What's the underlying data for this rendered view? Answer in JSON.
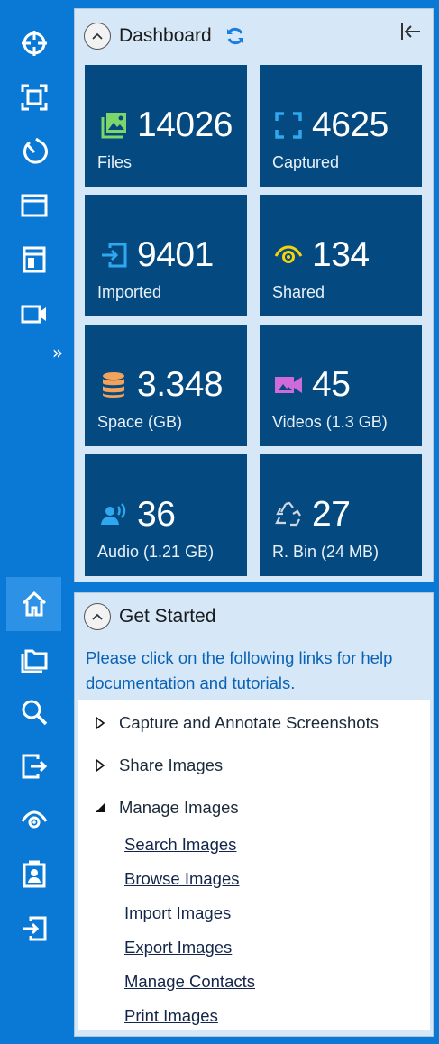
{
  "sidebar": {
    "top_buttons": [
      {
        "name": "crosshair-icon"
      },
      {
        "name": "region-capture-icon"
      },
      {
        "name": "timer-capture-icon"
      },
      {
        "name": "window-capture-icon"
      },
      {
        "name": "scroll-capture-icon"
      },
      {
        "name": "video-capture-icon"
      }
    ],
    "expand_glyph": "»",
    "bottom_buttons": [
      {
        "name": "home-icon",
        "active": true
      },
      {
        "name": "browse-icon"
      },
      {
        "name": "search-icon"
      },
      {
        "name": "export-icon"
      },
      {
        "name": "share-icon"
      },
      {
        "name": "contacts-icon"
      },
      {
        "name": "import-icon"
      }
    ]
  },
  "dashboard": {
    "title": "Dashboard",
    "tiles": [
      {
        "value": "14026",
        "label": "Files",
        "icon": "image-icon",
        "color": "#7dd66b"
      },
      {
        "value": "4625",
        "label": "Captured",
        "icon": "capture-frame-icon",
        "color": "#2fa8f0"
      },
      {
        "value": "9401",
        "label": "Imported",
        "icon": "import-icon",
        "color": "#2fa8f0"
      },
      {
        "value": "134",
        "label": "Shared",
        "icon": "share-eye-icon",
        "color": "#f5d30a"
      },
      {
        "value": "3.348",
        "label": "Space (GB)",
        "icon": "database-icon",
        "color": "#f2a25a"
      },
      {
        "value": "45",
        "label": "Videos (1.3 GB)",
        "icon": "video-icon",
        "color": "#d06ad8"
      },
      {
        "value": "36",
        "label": "Audio (1.21 GB)",
        "icon": "speaker-icon",
        "color": "#2fa8f0"
      },
      {
        "value": "27",
        "label": "R. Bin (24 MB)",
        "icon": "recycle-icon",
        "color": "#cfd8e2"
      }
    ]
  },
  "get_started": {
    "title": "Get Started",
    "description": "Please click on the following links for help documentation and tutorials.",
    "sections": [
      {
        "label": "Capture and Annotate Screenshots",
        "expanded": false
      },
      {
        "label": "Share Images",
        "expanded": false
      },
      {
        "label": "Manage Images",
        "expanded": true
      }
    ],
    "links": [
      "Search Images",
      "Browse Images",
      "Import Images",
      "Export Images",
      "Manage Contacts",
      "Print Images"
    ]
  },
  "colors": {
    "sidebar": "#0a79d6",
    "panel": "#d6e7f7",
    "tile": "#044a81",
    "link_text": "#0a62b4"
  }
}
